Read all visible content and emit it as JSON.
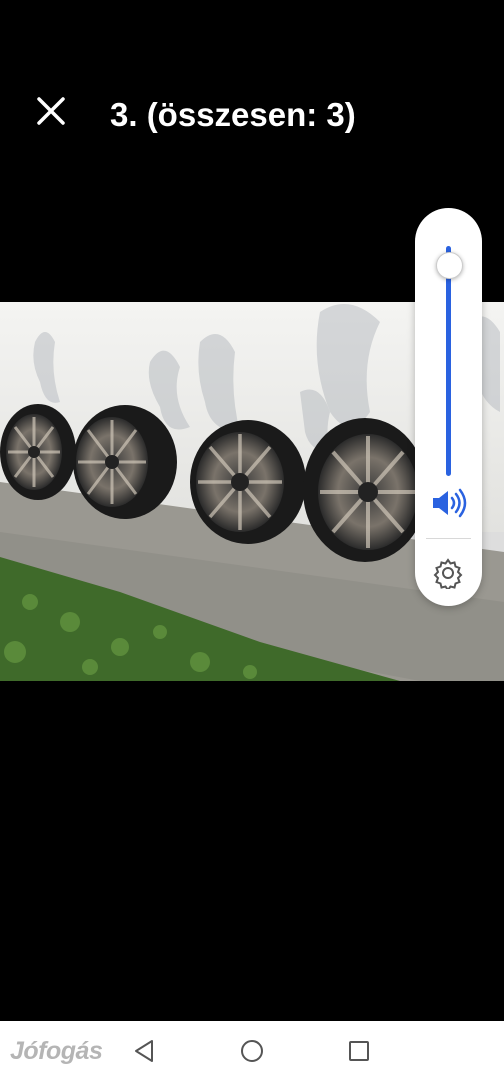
{
  "header": {
    "close_icon": "close-icon",
    "title": "3. (összesen: 3)"
  },
  "photo": {
    "subject": "four-alloy-wheels-leaning-on-wall"
  },
  "volume_panel": {
    "level": 0.92,
    "accent": "#2a62e0",
    "speaker_icon": "volume-icon",
    "settings_icon": "gear-icon"
  },
  "navbar": {
    "back_icon": "back-triangle-icon",
    "home_icon": "home-circle-icon",
    "recent_icon": "recent-square-icon"
  },
  "watermark": "Jófogás"
}
